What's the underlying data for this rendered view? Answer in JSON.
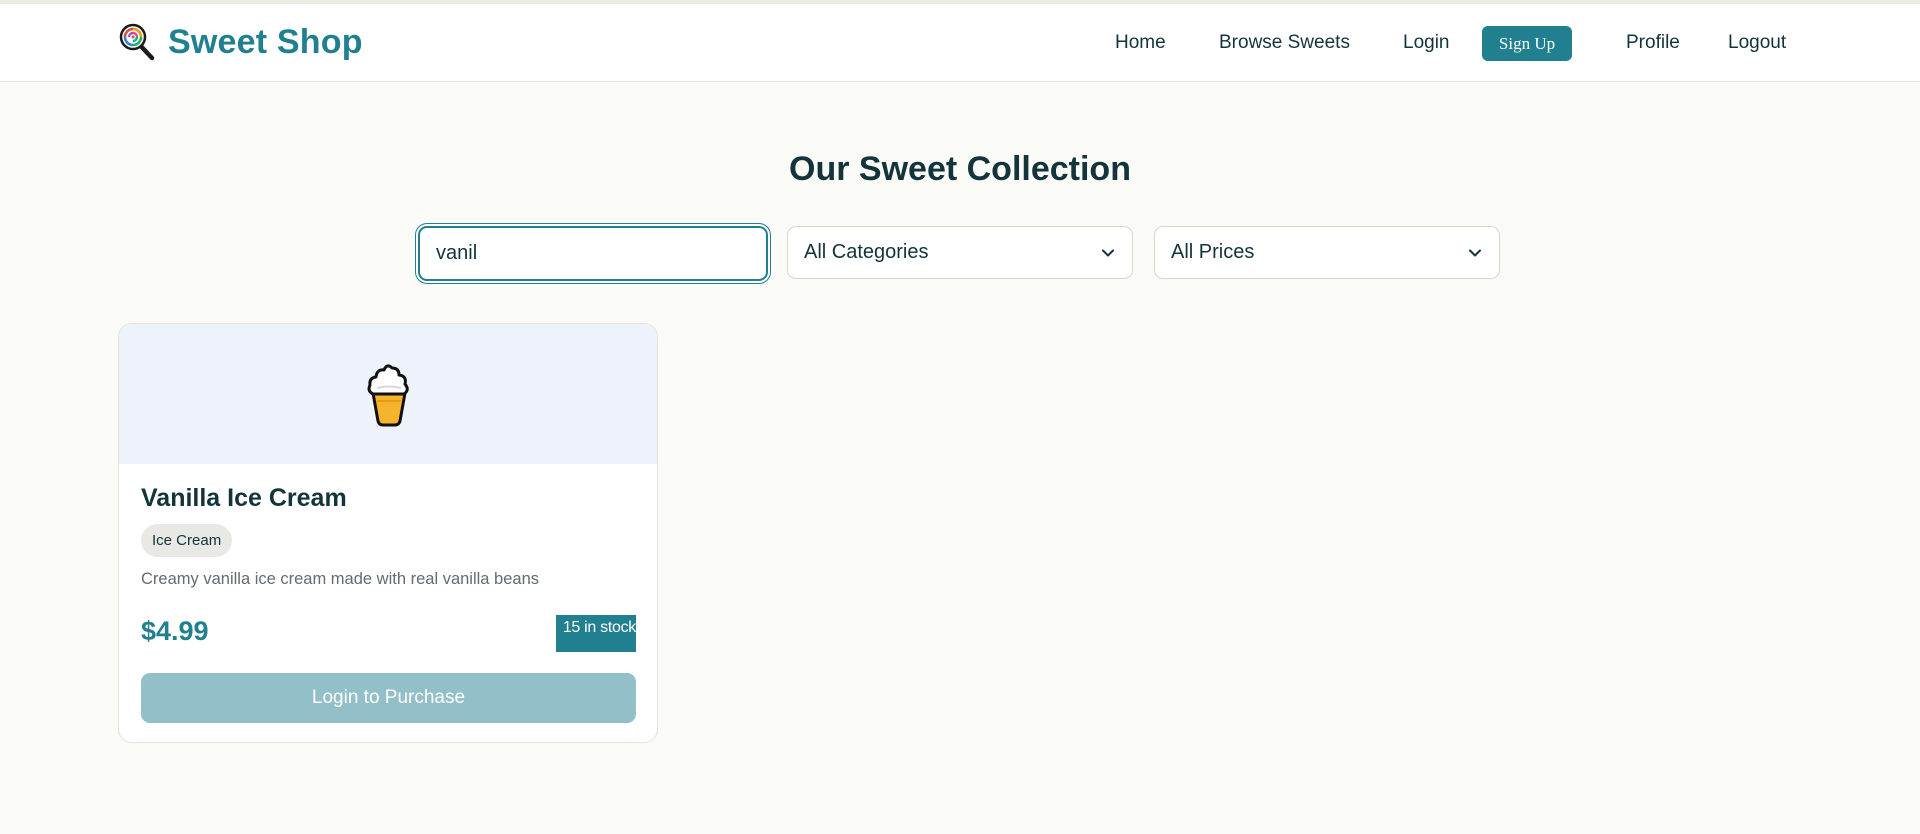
{
  "header": {
    "brand": "Sweet Shop",
    "brand_icon": "lollipop-icon",
    "nav": {
      "home": "Home",
      "browse": "Browse Sweets",
      "login": "Login",
      "signup": "Sign Up",
      "profile": "Profile",
      "logout": "Logout"
    }
  },
  "main": {
    "title": "Our Sweet Collection",
    "filters": {
      "search_value": "vanil",
      "category_selected": "All Categories",
      "price_selected": "All Prices"
    },
    "products": [
      {
        "icon": "ice-cream-icon",
        "name": "Vanilla Ice Cream",
        "category": "Ice Cream",
        "description": "Creamy vanilla ice cream made with real vanilla beans",
        "price": "$4.99",
        "stock": "15 in stock",
        "action": "Login to Purchase"
      }
    ]
  },
  "colors": {
    "accent": "#218090",
    "background": "#fafaf7",
    "card_image_bg": "#eef3fb",
    "disabled_button": "#93c0c8"
  }
}
